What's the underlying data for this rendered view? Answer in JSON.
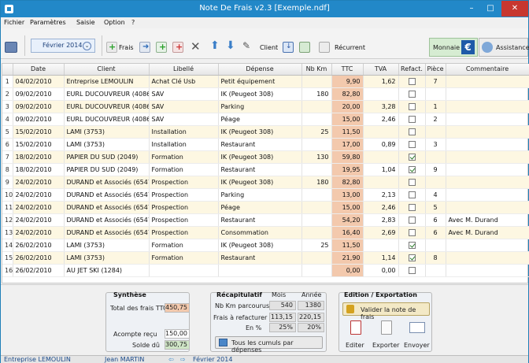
{
  "window": {
    "title": "Note De Frais v2.3 [Exemple.ndf]",
    "min": "–",
    "max": "□",
    "close": "✕"
  },
  "menu": [
    "Fichier",
    "Paramètres",
    "Saisie",
    "Option",
    "?"
  ],
  "toolbar": {
    "month": "Février 2014",
    "frais": "Frais",
    "client": "Client",
    "recurrent": "Récurrent",
    "monnaie": "Monnaie",
    "currency_symbol": "€",
    "assistance": "Assistance"
  },
  "columns": [
    "",
    "Date",
    "Client",
    "Libellé",
    "Dépense",
    "Nb Km",
    "TTC",
    "TVA",
    "Refact.",
    "Pièce",
    "Commentaire"
  ],
  "rows": [
    {
      "n": "1",
      "date": "04/02/2010",
      "client": "Entreprise LEMOULIN",
      "libelle": "Achat Clé Usb",
      "depense": "Petit équipement",
      "km": "",
      "ttc": "9,90",
      "tva": "1,62",
      "refact": false,
      "piece": "7",
      "comment": ""
    },
    {
      "n": "2",
      "date": "09/02/2010",
      "client": "EURL DUCOUVREUR (4086)",
      "libelle": "SAV",
      "depense": "IK (Peugeot 308)",
      "km": "180",
      "ttc": "82,80",
      "tva": "",
      "refact": false,
      "piece": "",
      "comment": ""
    },
    {
      "n": "3",
      "date": "09/02/2010",
      "client": "EURL DUCOUVREUR (4086)",
      "libelle": "SAV",
      "depense": "Parking",
      "km": "",
      "ttc": "20,00",
      "tva": "3,28",
      "refact": false,
      "piece": "1",
      "comment": ""
    },
    {
      "n": "4",
      "date": "09/02/2010",
      "client": "EURL DUCOUVREUR (4086)",
      "libelle": "SAV",
      "depense": "Péage",
      "km": "",
      "ttc": "15,00",
      "tva": "2,46",
      "refact": false,
      "piece": "2",
      "comment": ""
    },
    {
      "n": "5",
      "date": "15/02/2010",
      "client": "LAMI (3753)",
      "libelle": "Installation",
      "depense": "IK (Peugeot 308)",
      "km": "25",
      "ttc": "11,50",
      "tva": "",
      "refact": false,
      "piece": "",
      "comment": ""
    },
    {
      "n": "6",
      "date": "15/02/2010",
      "client": "LAMI (3753)",
      "libelle": "Installation",
      "depense": "Restaurant",
      "km": "",
      "ttc": "17,00",
      "tva": "0,89",
      "refact": false,
      "piece": "3",
      "comment": ""
    },
    {
      "n": "7",
      "date": "18/02/2010",
      "client": "PAPIER DU SUD (2049)",
      "libelle": "Formation",
      "depense": "IK (Peugeot 308)",
      "km": "130",
      "ttc": "59,80",
      "tva": "",
      "refact": true,
      "piece": "",
      "comment": ""
    },
    {
      "n": "8",
      "date": "18/02/2010",
      "client": "PAPIER DU SUD (2049)",
      "libelle": "Formation",
      "depense": "Restaurant",
      "km": "",
      "ttc": "19,95",
      "tva": "1,04",
      "refact": true,
      "piece": "9",
      "comment": ""
    },
    {
      "n": "9",
      "date": "24/02/2010",
      "client": "DURAND et Associés (6547)",
      "libelle": "Prospection",
      "depense": "IK (Peugeot 308)",
      "km": "180",
      "ttc": "82,80",
      "tva": "",
      "refact": false,
      "piece": "",
      "comment": ""
    },
    {
      "n": "10",
      "date": "24/02/2010",
      "client": "DURAND et Associés (6547)",
      "libelle": "Prospection",
      "depense": "Parking",
      "km": "",
      "ttc": "13,00",
      "tva": "2,13",
      "refact": false,
      "piece": "4",
      "comment": ""
    },
    {
      "n": "11",
      "date": "24/02/2010",
      "client": "DURAND et Associés (6547)",
      "libelle": "Prospection",
      "depense": "Péage",
      "km": "",
      "ttc": "15,00",
      "tva": "2,46",
      "refact": false,
      "piece": "5",
      "comment": ""
    },
    {
      "n": "12",
      "date": "24/02/2010",
      "client": "DURAND et Associés (6547)",
      "libelle": "Prospection",
      "depense": "Restaurant",
      "km": "",
      "ttc": "54,20",
      "tva": "2,83",
      "refact": false,
      "piece": "6",
      "comment": "Avec M. Durand"
    },
    {
      "n": "13",
      "date": "24/02/2010",
      "client": "DURAND et Associés (6547)",
      "libelle": "Prospection",
      "depense": "Consommation",
      "km": "",
      "ttc": "16,40",
      "tva": "2,69",
      "refact": false,
      "piece": "6",
      "comment": "Avec M. Durand"
    },
    {
      "n": "14",
      "date": "26/02/2010",
      "client": "LAMI (3753)",
      "libelle": "Formation",
      "depense": "IK (Peugeot 308)",
      "km": "25",
      "ttc": "11,50",
      "tva": "",
      "refact": true,
      "piece": "",
      "comment": ""
    },
    {
      "n": "15",
      "date": "26/02/2010",
      "client": "LAMI (3753)",
      "libelle": "Formation",
      "depense": "Restaurant",
      "km": "",
      "ttc": "21,90",
      "tva": "1,14",
      "refact": true,
      "piece": "8",
      "comment": ""
    },
    {
      "n": "16",
      "date": "26/02/2010",
      "client": "AU JET SKI (1284)",
      "libelle": "",
      "depense": "",
      "km": "",
      "ttc": "0,00",
      "tva": "0,00",
      "refact": false,
      "piece": "",
      "comment": ""
    }
  ],
  "synthese": {
    "title": "Synthèse",
    "total_label": "Total des frais TTC",
    "total": "450,75",
    "acompte_label": "Acompte reçu",
    "acompte": "150,00",
    "solde_label": "Solde dû",
    "solde": "300,75"
  },
  "recap": {
    "title": "Récapitulatif",
    "mois": "Mois",
    "annee": "Année",
    "km_label": "Nb Km parcourus",
    "km_mois": "540",
    "km_annee": "1380",
    "refact_label": "Frais à refacturer",
    "refact_mois": "113,15",
    "refact_annee": "220,15",
    "pct_label": "En %",
    "pct_mois": "25%",
    "pct_annee": "20%",
    "cumuls": "Tous les cumuls par dépenses"
  },
  "edition": {
    "title": "Edition / Exportation",
    "valider": "Valider la note de frais",
    "editer": "Editer",
    "exporter": "Exporter",
    "envoyer": "Envoyer"
  },
  "status": {
    "company": "Entreprise LEMOULIN",
    "user": "Jean MARTIN",
    "month": "Février 2014"
  }
}
